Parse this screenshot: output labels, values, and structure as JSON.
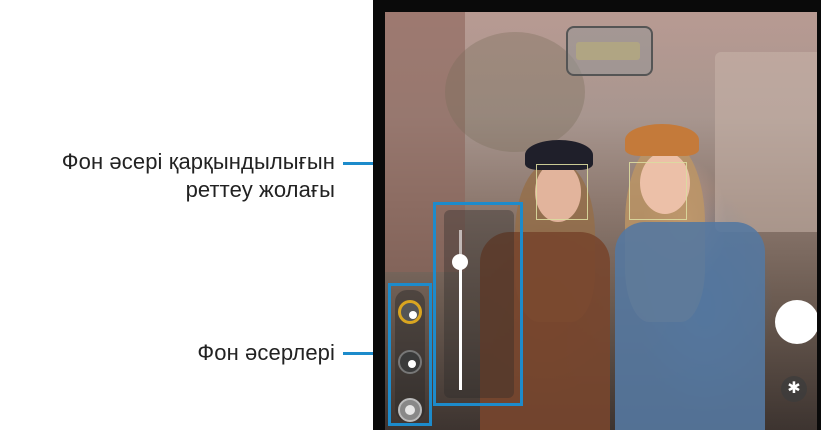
{
  "callouts": {
    "slider_line1": "Фон әсері қарқындылығын",
    "slider_line2": "реттеу жолағы",
    "effects": "Фон әсерлері"
  },
  "colors": {
    "callout_line": "#1d8bcb",
    "selected_effect_ring": "#d9a520"
  },
  "camera": {
    "shutter_icon": "shutter-button",
    "settings_icon": "asterisk-icon",
    "settings_glyph": "✱",
    "effect_intensity": 0.8,
    "effects": [
      {
        "name": "effect-1",
        "selected": true
      },
      {
        "name": "effect-2",
        "selected": false
      },
      {
        "name": "effect-3",
        "selected": false
      }
    ]
  }
}
